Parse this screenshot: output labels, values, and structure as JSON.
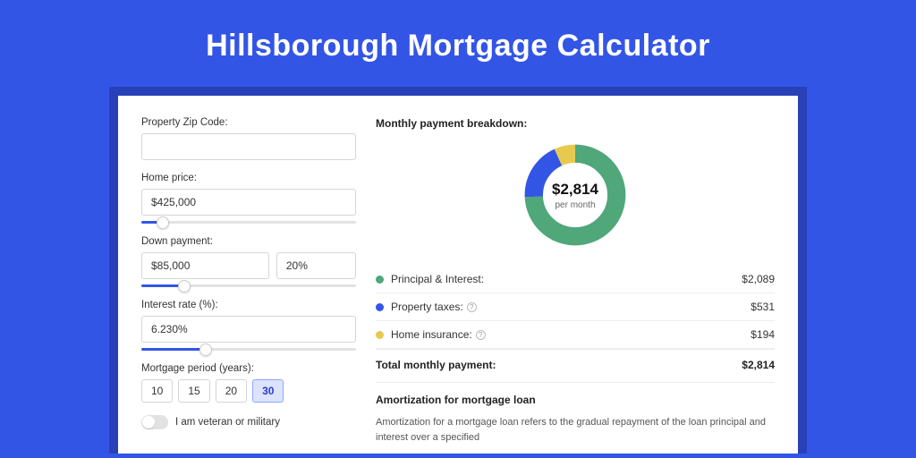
{
  "title": "Hillsborough Mortgage Calculator",
  "form": {
    "zip_label": "Property Zip Code:",
    "zip_value": "",
    "price_label": "Home price:",
    "price_value": "$425,000",
    "price_slider_pct": 10,
    "down_label": "Down payment:",
    "down_value": "$85,000",
    "down_pct_value": "20%",
    "down_slider_pct": 20,
    "rate_label": "Interest rate (%):",
    "rate_value": "6.230%",
    "rate_slider_pct": 30,
    "period_label": "Mortgage period (years):",
    "periods": [
      "10",
      "15",
      "20",
      "30"
    ],
    "period_selected": "30",
    "veteran_label": "I am veteran or military"
  },
  "breakdown": {
    "title": "Monthly payment breakdown:",
    "center_value": "$2,814",
    "center_sub": "per month",
    "items": [
      {
        "label": "Principal & Interest:",
        "amount": "$2,089",
        "color": "green",
        "info": false
      },
      {
        "label": "Property taxes:",
        "amount": "$531",
        "color": "blue",
        "info": true
      },
      {
        "label": "Home insurance:",
        "amount": "$194",
        "color": "yellow",
        "info": true
      }
    ],
    "total_label": "Total monthly payment:",
    "total_amount": "$2,814"
  },
  "amortization": {
    "title": "Amortization for mortgage loan",
    "text": "Amortization for a mortgage loan refers to the gradual repayment of the loan principal and interest over a specified"
  },
  "chart_data": {
    "type": "pie",
    "title": "Monthly payment breakdown",
    "series": [
      {
        "name": "Principal & Interest",
        "value": 2089,
        "color": "#4fa77a"
      },
      {
        "name": "Property taxes",
        "value": 531,
        "color": "#3355e6"
      },
      {
        "name": "Home insurance",
        "value": 194,
        "color": "#e8c94f"
      }
    ],
    "total": 2814,
    "center_label": "$2,814 per month"
  }
}
